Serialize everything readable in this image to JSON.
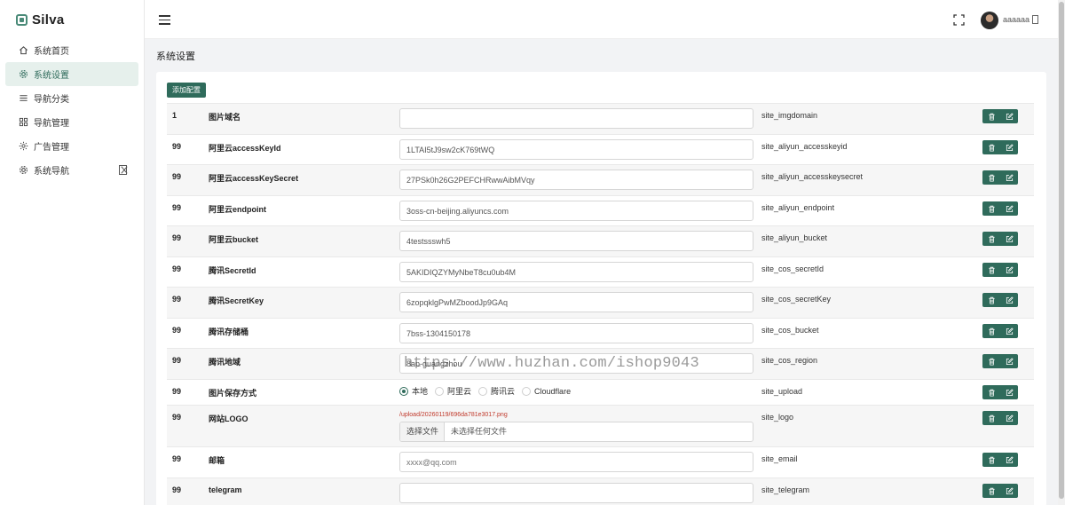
{
  "app": {
    "name": "Silva"
  },
  "sidebar": {
    "items": [
      {
        "label": "系统首页",
        "icon": "home-icon",
        "active": false
      },
      {
        "label": "系统设置",
        "icon": "gear-icon",
        "active": true
      },
      {
        "label": "导航分类",
        "icon": "list-icon",
        "active": false
      },
      {
        "label": "导航管理",
        "icon": "grid-icon",
        "active": false
      },
      {
        "label": "广告管理",
        "icon": "sun-icon",
        "active": false
      },
      {
        "label": "系统导航",
        "icon": "gear-icon",
        "active": false
      }
    ]
  },
  "header": {
    "username": "aaaaaa"
  },
  "page": {
    "title": "系统设置",
    "add_button": "添加配置"
  },
  "rows": [
    {
      "id": "1",
      "name": "图片域名",
      "value": "",
      "key": "site_imgdomain"
    },
    {
      "id": "99",
      "name": "阿里云accessKeyId",
      "value": "1LTAI5tJ9sw2cK769tWQ",
      "key": "site_aliyun_accesskeyid"
    },
    {
      "id": "99",
      "name": "阿里云accessKeySecret",
      "value": "27PSk0h26G2PEFCHRwwAibMVqy",
      "key": "site_aliyun_accesskeysecret"
    },
    {
      "id": "99",
      "name": "阿里云endpoint",
      "value": "3oss-cn-beijing.aliyuncs.com",
      "key": "site_aliyun_endpoint"
    },
    {
      "id": "99",
      "name": "阿里云bucket",
      "value": "4testssswh5",
      "key": "site_aliyun_bucket"
    },
    {
      "id": "99",
      "name": "腾讯SecretId",
      "value": "5AKIDIQZYMyNbeT8cu0ub4M",
      "key": "site_cos_secretId"
    },
    {
      "id": "99",
      "name": "腾讯SecretKey",
      "value": "6zopqklgPwMZboodJp9GAq",
      "key": "site_cos_secretKey"
    },
    {
      "id": "99",
      "name": "腾讯存储桶",
      "value": "7bss-1304150178",
      "key": "site_cos_bucket"
    },
    {
      "id": "99",
      "name": "腾讯地域",
      "value": "8ap-guangzhou",
      "key": "site_cos_region"
    },
    {
      "id": "99",
      "name": "图片保存方式",
      "key": "site_upload",
      "options": [
        "本地",
        "阿里云",
        "腾讯云",
        "Cloudflare"
      ],
      "selected": "本地"
    },
    {
      "id": "99",
      "name": "网站LOGO",
      "key": "site_logo",
      "path": "/upload/20260119/696da781e3017.png",
      "file_button": "选择文件",
      "file_status": "未选择任何文件"
    },
    {
      "id": "99",
      "name": "邮箱",
      "value": "",
      "placeholder": "xxxx@qq.com",
      "key": "site_email"
    },
    {
      "id": "99",
      "name": "telegram",
      "value": "",
      "key": "site_telegram"
    }
  ],
  "watermark": "https://www.huzhan.com/ishop9043",
  "colors": {
    "accent": "#2f6b5b",
    "active_bg": "#e6f0ec",
    "path_red": "#c0392b"
  }
}
